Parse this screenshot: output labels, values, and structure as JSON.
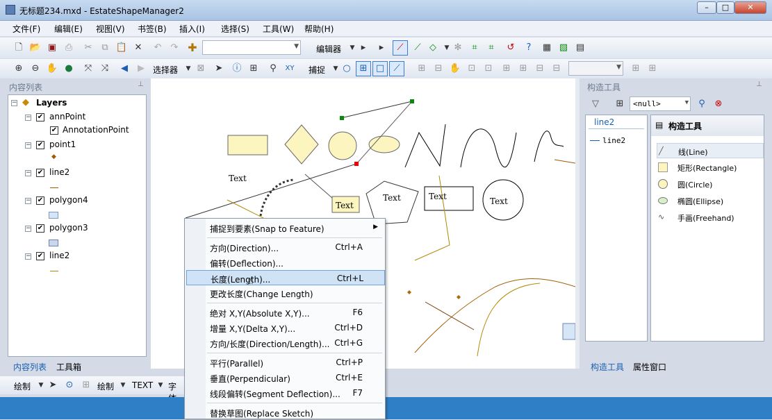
{
  "window": {
    "title": "无标题234.mxd - EstateShapeManager2"
  },
  "menubar": [
    "文件(F)",
    "编辑(E)",
    "视图(V)",
    "书签(B)",
    "插入(I)",
    "选择(S)",
    "工具(W)",
    "帮助(H)"
  ],
  "toolbar": {
    "editor_label": "编辑器",
    "selector_label": "选择器",
    "snap_label": "捕捉"
  },
  "left_panel": {
    "header": "内容列表",
    "layers_root": "Layers",
    "layers": [
      {
        "name": "annPoint",
        "checked": true,
        "children": [
          "AnnotationPoint"
        ]
      },
      {
        "name": "point1",
        "checked": true
      },
      {
        "name": "line2",
        "checked": true
      },
      {
        "name": "polygon4",
        "checked": true
      },
      {
        "name": "polygon3",
        "checked": true
      },
      {
        "name": "line2",
        "checked": true
      }
    ],
    "tabs": [
      "内容列表",
      "工具箱"
    ]
  },
  "right_panel": {
    "header": "构造工具",
    "combo_value": "<null>",
    "template_header": "line2",
    "template_item": "line2",
    "tools_header": "构造工具",
    "tools": [
      "线(Line)",
      "矩形(Rectangle)",
      "圆(Circle)",
      "椭圆(Ellipse)",
      "手画(Freehand)"
    ],
    "tabs": [
      "构造工具",
      "属性窗口"
    ]
  },
  "map_labels": [
    "Text",
    "Text",
    "Text",
    "Text",
    "Text"
  ],
  "context_menu": {
    "items": [
      {
        "label": "捕捉到要素(Snap to Feature)",
        "shortcut": "",
        "submenu": true
      },
      {
        "label": "方向(Direction)...",
        "shortcut": "Ctrl+A"
      },
      {
        "label": "偏转(Deflection)...",
        "shortcut": ""
      },
      {
        "label": "长度(Length)...",
        "shortcut": "Ctrl+L",
        "highlighted": true
      },
      {
        "label": "更改长度(Change Length)",
        "shortcut": ""
      },
      {
        "label": "绝对 X,Y(Absolute X,Y)...",
        "shortcut": "F6"
      },
      {
        "label": "增量 X,Y(Delta X,Y)...",
        "shortcut": "Ctrl+D"
      },
      {
        "label": "方向/长度(Direction/Length)...",
        "shortcut": "Ctrl+G"
      },
      {
        "label": "平行(Parallel)",
        "shortcut": "Ctrl+P"
      },
      {
        "label": "垂直(Perpendicular)",
        "shortcut": "Ctrl+E"
      },
      {
        "label": "线段偏转(Segment Deflection)...",
        "shortcut": "F7"
      },
      {
        "label": "替换草图(Replace Sketch)",
        "shortcut": ""
      }
    ]
  },
  "bottom_toolbar": {
    "draw1": "绘制",
    "draw2": "绘制",
    "text": "TEXT",
    "font": "字体"
  },
  "colors": {
    "statusbar": "#2f7fc6",
    "highlight": "#cfe3f7",
    "accent_tab": "#1a5fb4"
  }
}
